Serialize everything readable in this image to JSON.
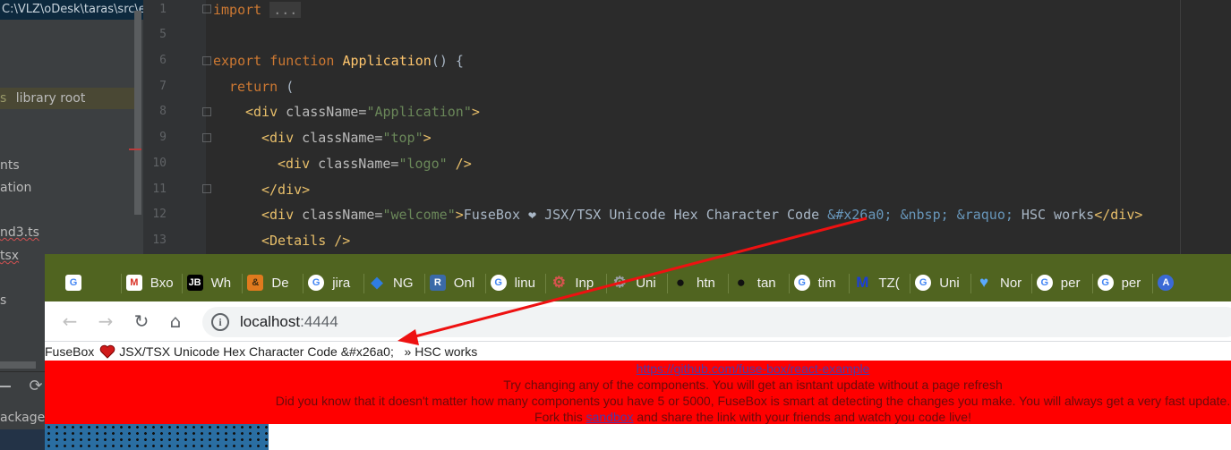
{
  "ide": {
    "project_path": "C:\\VLZ\\oDesk\\taras\\src\\e",
    "tree": {
      "library_prefix": "s",
      "library_label": "library root",
      "item_nts": "nts",
      "item_ation": "ation",
      "item_nd3": "nd3.ts",
      "item_tsx": "tsx",
      "item_s": "s",
      "package_label": "ackage."
    },
    "line_numbers": [
      "1",
      "5",
      "6",
      "7",
      "8",
      "9",
      "10",
      "11",
      "12",
      "13"
    ],
    "code": {
      "l1_kw": "import",
      "l1_fold": "...",
      "l6_kw": "export function",
      "l6_fn": "Application",
      "l6_rest": "() {",
      "l7_kw": "return",
      "l7_rest": " (",
      "l8_open": "<div",
      "l8_attr": " className=",
      "l8_val": "\"Application\"",
      "l8_close": ">",
      "l9_open": "<div",
      "l9_attr": " className=",
      "l9_val": "\"top\"",
      "l9_close": ">",
      "l10_open": "<div",
      "l10_attr": " className=",
      "l10_val": "\"logo\"",
      "l10_close": " />",
      "l11_close": "</div>",
      "l12_open": "<div",
      "l12_attr": " className=",
      "l12_val": "\"welcome\"",
      "l12_gt": ">",
      "l12_text1": "FuseBox ❤ JSX/TSX Unicode Hex Character Code ",
      "l12_ent": "&#x26a0; &nbsp; &raquo;",
      "l12_text2": " HSC works",
      "l12_end": "</div>",
      "l13_open": "<Details",
      "l13_close": " />"
    }
  },
  "browser": {
    "bookmarks": [
      {
        "icon": "google-translate-icon",
        "label": ""
      },
      {
        "icon": "gmail-icon",
        "label": "Bxo"
      },
      {
        "icon": "jb-icon",
        "label": "Wh"
      },
      {
        "icon": "ampersand-icon",
        "label": "De"
      },
      {
        "icon": "google-icon",
        "label": "jira"
      },
      {
        "icon": "diamond-icon",
        "label": "NG"
      },
      {
        "icon": "r-icon",
        "label": "Onl"
      },
      {
        "icon": "google-icon",
        "label": "linu"
      },
      {
        "icon": "robot-icon",
        "label": "Inp"
      },
      {
        "icon": "gear-icon",
        "label": "Uni"
      },
      {
        "icon": "github-icon",
        "label": "htn"
      },
      {
        "icon": "github-icon",
        "label": "tan"
      },
      {
        "icon": "google-icon",
        "label": "tim"
      },
      {
        "icon": "m-logo-icon",
        "label": "TZ("
      },
      {
        "icon": "google-icon",
        "label": "Uni"
      },
      {
        "icon": "heart-icon",
        "label": "Nor"
      },
      {
        "icon": "google-icon",
        "label": "per"
      },
      {
        "icon": "google-icon",
        "label": "per"
      },
      {
        "icon": "a-icon",
        "label": ""
      }
    ],
    "url_host": "localhost",
    "url_port": ":4444",
    "page": {
      "welcome_before": "FuseBox",
      "welcome_after": "JSX/TSX Unicode Hex Character Code &#x26a0;   » HSC works",
      "details": {
        "link": "https://github.com/fuse-box/react-example",
        "line2": "Try changing any of the components. You will get an isntant update without a page refresh",
        "line3": "Did you know that it doesn't matter how many components you have 5 or 5000, FuseBox is smart at detecting the changes you make. You will always get a very fast update.",
        "line4_before": "Fork this ",
        "line4_link": "sandbox",
        "line4_after": " and share the link with your friends and watch you code live!"
      }
    }
  },
  "colors": {
    "page_red": "#ff0000",
    "bookmark_bar": "#506420",
    "editor_bg": "#2b2b2b"
  }
}
